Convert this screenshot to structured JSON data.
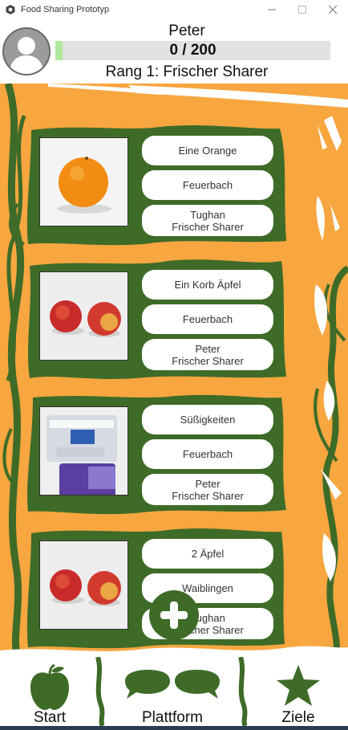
{
  "window": {
    "title": "Food Sharing Prototyp",
    "minimize_icon": "minimize-icon",
    "maximize_icon": "maximize-icon",
    "close_icon": "close-icon"
  },
  "profile": {
    "name": "Peter",
    "points_text": "0 / 200",
    "points_current": 0,
    "points_goal": 200,
    "progress_fraction": 0.0,
    "rank": "Rang 1: Frischer Sharer",
    "avatar_icon": "user-avatar-icon"
  },
  "listings": [
    {
      "item": "Eine Orange",
      "location": "Feuerbach",
      "owner_name": "Tughan",
      "owner_rank": "Frischer Sharer",
      "photo": "orange"
    },
    {
      "item": "Ein Korb Äpfel",
      "location": "Feuerbach",
      "owner_name": "Peter",
      "owner_rank": "Frischer Sharer",
      "photo": "two-apples"
    },
    {
      "item": "Süßigkeiten",
      "location": "Feuerbach",
      "owner_name": "Peter",
      "owner_rank": "Frischer Sharer",
      "photo": "sweets"
    },
    {
      "item": "2 Äpfel",
      "location": "Waiblingen",
      "owner_name": "Tughan",
      "owner_rank": "Frischer Sharer",
      "photo": "two-apples"
    }
  ],
  "add_button_icon": "plus-icon",
  "nav": {
    "start": "Start",
    "platform": "Plattform",
    "goals": "Ziele",
    "start_icon": "apple-icon",
    "platform_icon": "speech-bubbles-icon",
    "goals_icon": "star-icon"
  },
  "colors": {
    "background": "#f7a640",
    "vine": "#3e6b27",
    "progress_fill": "#aee89a",
    "progress_track": "#e2e2e2"
  }
}
